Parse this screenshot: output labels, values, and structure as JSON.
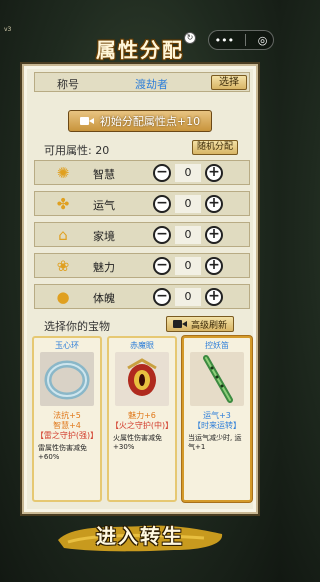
{
  "version": "v3",
  "capsule": {
    "more_icon": "more-dots-icon",
    "close_icon": "target-icon"
  },
  "title": "属性分配",
  "name_row": {
    "label": "称号",
    "value": "渡劫者",
    "button": "选择"
  },
  "init_button": "初始分配属性点+10",
  "available": {
    "text": "可用属性: 20",
    "random_button": "随机分配"
  },
  "attributes": [
    {
      "name": "智慧",
      "value": "0",
      "icon": "bulb-icon"
    },
    {
      "name": "运气",
      "value": "0",
      "icon": "clover-icon"
    },
    {
      "name": "家境",
      "value": "0",
      "icon": "house-icon"
    },
    {
      "name": "魅力",
      "value": "0",
      "icon": "flower-icon"
    },
    {
      "name": "体魄",
      "value": "0",
      "icon": "person-icon"
    }
  ],
  "treasure": {
    "label": "选择你的宝物",
    "refresh_button": "高级刷新"
  },
  "cards": [
    {
      "name": "玉心环",
      "stat1": "法抗+5",
      "stat2": "智慧+4",
      "tag": "【雷之守护(强)】",
      "desc": "雷属性伤害减免+60%",
      "icon": "jade-ring-icon"
    },
    {
      "name": "赤魔眼",
      "stat1": "魅力+6",
      "stat2": "",
      "tag": "【火之守护(中)】",
      "desc": "火属性伤害减免+30%",
      "icon": "demon-eye-icon"
    },
    {
      "name": "控妖笛",
      "stat1": "运气+3",
      "stat2": "",
      "tag": "【时来运转】",
      "desc": "当运气减少时, 运气+1",
      "icon": "flute-icon"
    }
  ],
  "enter_button": "进入转生",
  "colors": {
    "accent": "#2f7fd9",
    "stat_orange": "#e0781a",
    "tag_red": "#d23c2c",
    "panel": "#eeebd9"
  }
}
